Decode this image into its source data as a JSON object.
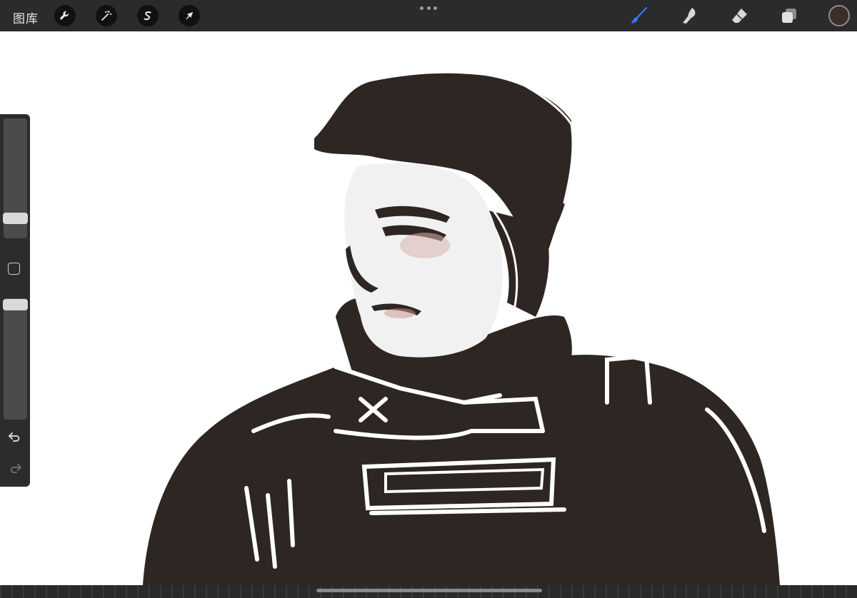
{
  "topbar": {
    "gallery_label": "图库",
    "left_tools": [
      {
        "name": "actions",
        "icon": "wrench-icon"
      },
      {
        "name": "adjustments",
        "icon": "magic-wand-icon"
      },
      {
        "name": "selection",
        "icon": "selection-s-icon"
      },
      {
        "name": "transform",
        "icon": "arrow-cursor-icon"
      }
    ],
    "right_tools": [
      {
        "name": "brush",
        "icon": "brush-icon",
        "active": true
      },
      {
        "name": "smudge",
        "icon": "smudge-icon",
        "active": false
      },
      {
        "name": "eraser",
        "icon": "eraser-icon",
        "active": false
      },
      {
        "name": "layers",
        "icon": "layers-icon",
        "active": false
      }
    ],
    "current_color": "#3b2e28",
    "accent_color": "#2f7dff"
  },
  "sidebar": {
    "brush_size_level": 0.25,
    "opacity_level": 0.92,
    "icons": [
      "modifier-square-icon",
      "undo-icon",
      "redo-icon"
    ]
  },
  "canvas": {
    "background": "#ffffff",
    "ink_color": "#2d2622"
  }
}
